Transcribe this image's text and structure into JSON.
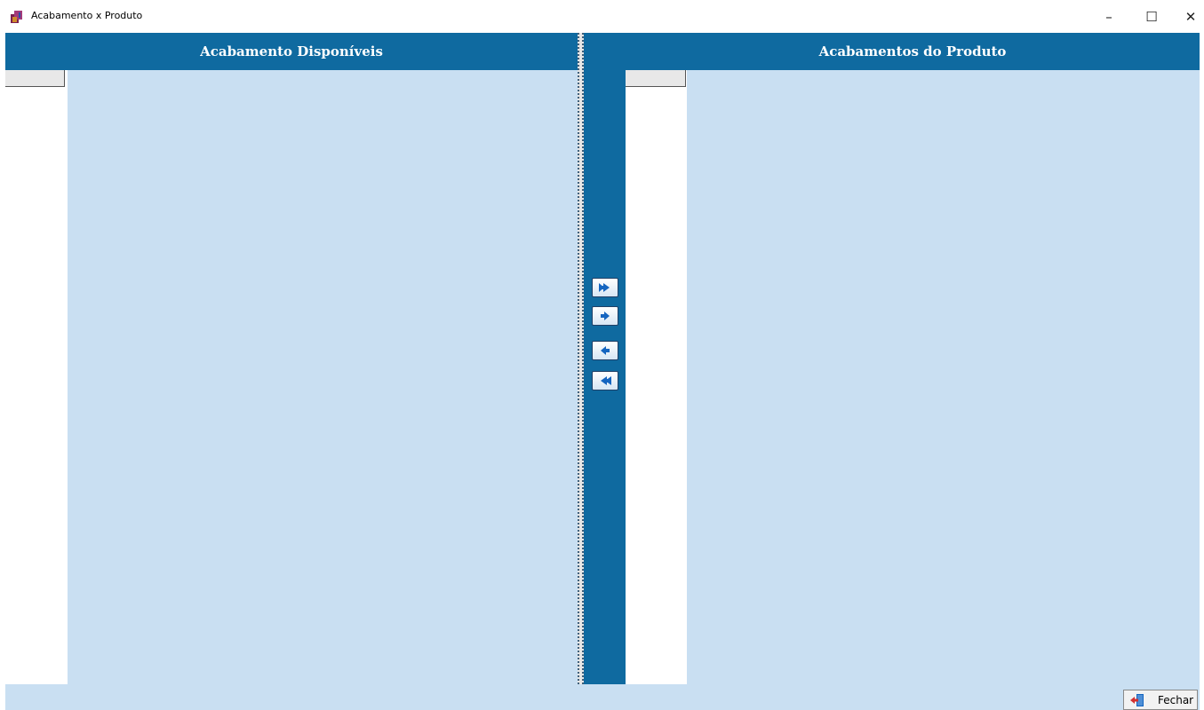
{
  "window": {
    "title": "Acabamento x Produto",
    "icon": "app-icon",
    "controls": {
      "minimize": "–",
      "maximize": "☐",
      "close": "✕"
    }
  },
  "left_panel": {
    "header": "Acabamento Disponíveis",
    "rows": []
  },
  "right_panel": {
    "header": "Acabamentos do Produto",
    "rows": []
  },
  "transfer_buttons": [
    {
      "icon": "double-arrow-right-icon"
    },
    {
      "icon": "arrow-right-icon"
    },
    {
      "icon": "arrow-left-icon"
    },
    {
      "icon": "double-arrow-left-icon"
    }
  ],
  "footer": {
    "close_label": "Fechar",
    "close_icon": "exit-door-icon"
  },
  "colors": {
    "header_bg": "#0f6aa0",
    "grid_bg": "#c9dff2",
    "arrow_blue": "#1565c0"
  }
}
